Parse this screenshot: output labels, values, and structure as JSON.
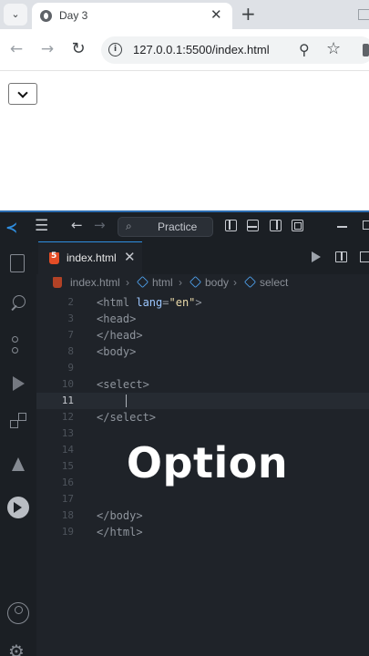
{
  "browser": {
    "tab_title": "Day 3",
    "url": "127.0.0.1:5500/index.html"
  },
  "vscode": {
    "search_text": "Practice",
    "editor_tab": "index.html",
    "breadcrumbs": [
      "index.html",
      "html",
      "body",
      "select"
    ],
    "code_lines": [
      {
        "n": "2",
        "parts": [
          [
            "tag",
            "<html "
          ],
          [
            "attr",
            "lang"
          ],
          [
            "tag",
            "="
          ],
          [
            "val",
            "\"en\""
          ],
          [
            "tag",
            ">"
          ]
        ]
      },
      {
        "n": "3",
        "parts": [
          [
            "tag",
            "<head>"
          ]
        ]
      },
      {
        "n": "7",
        "parts": [
          [
            "tag",
            "</head>"
          ]
        ]
      },
      {
        "n": "8",
        "parts": [
          [
            "tag",
            "<body>"
          ]
        ]
      },
      {
        "n": "9",
        "parts": []
      },
      {
        "n": "10",
        "parts": [
          [
            "tag",
            "<select>"
          ]
        ]
      },
      {
        "n": "11",
        "parts": [],
        "active": true
      },
      {
        "n": "12",
        "parts": [
          [
            "tag",
            "</select>"
          ]
        ]
      },
      {
        "n": "13",
        "parts": []
      },
      {
        "n": "14",
        "parts": []
      },
      {
        "n": "15",
        "parts": []
      },
      {
        "n": "16",
        "parts": []
      },
      {
        "n": "17",
        "parts": []
      },
      {
        "n": "18",
        "parts": [
          [
            "tag",
            "</body>"
          ]
        ]
      },
      {
        "n": "19",
        "parts": [
          [
            "tag",
            "</html>"
          ]
        ]
      }
    ]
  },
  "caption": "Option",
  "colors": {
    "accent": "#2f8ee0",
    "editor_bg": "#1f2329",
    "html_icon": "#e44d26"
  }
}
